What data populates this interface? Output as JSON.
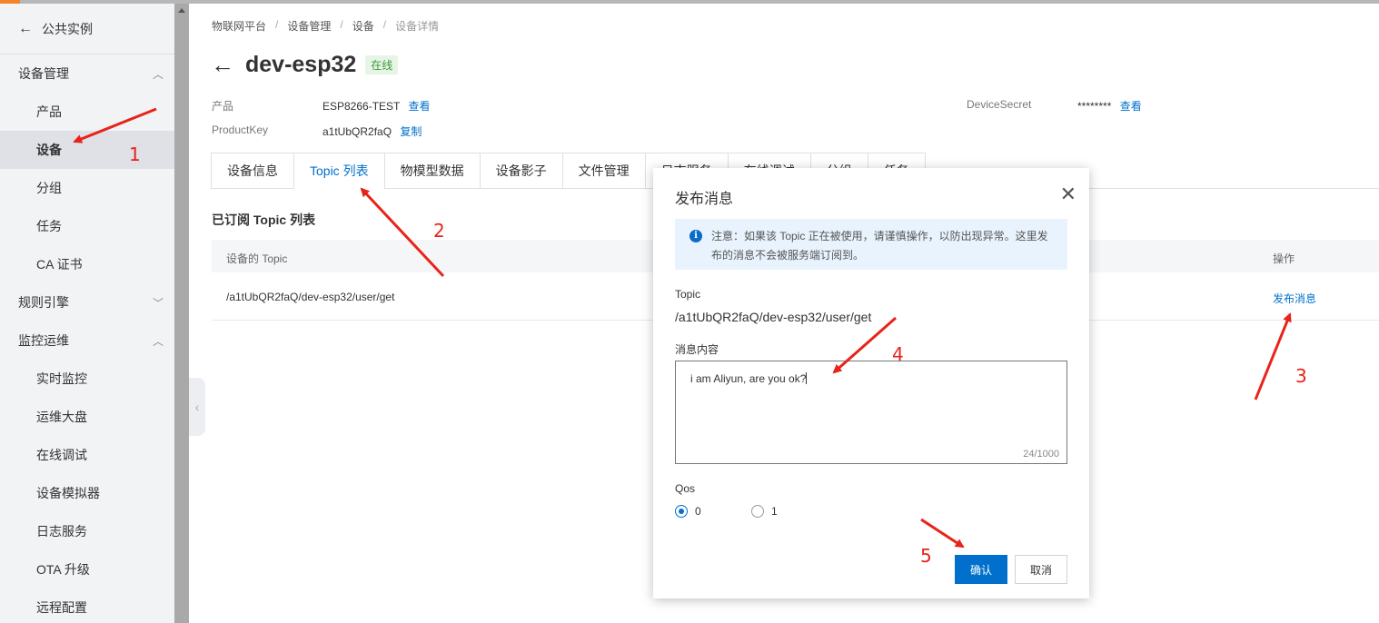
{
  "sidebar": {
    "back_label": "公共实例",
    "groups": [
      {
        "label": "设备管理",
        "items": [
          "产品",
          "设备",
          "分组",
          "任务",
          "CA 证书"
        ]
      },
      {
        "label": "规则引擎",
        "items": []
      },
      {
        "label": "监控运维",
        "items": [
          "实时监控",
          "运维大盘",
          "在线调试",
          "设备模拟器",
          "日志服务",
          "OTA 升级",
          "远程配置"
        ]
      }
    ],
    "active_item": "设备"
  },
  "breadcrumb": [
    "物联网平台",
    "设备管理",
    "设备",
    "设备详情"
  ],
  "device": {
    "name": "dev-esp32",
    "status": "在线",
    "product_label": "产品",
    "product_value": "ESP8266-TEST",
    "product_action": "查看",
    "productkey_label": "ProductKey",
    "productkey_value": "a1tUbQR2faQ",
    "productkey_action": "复制",
    "secret_label": "DeviceSecret",
    "secret_value": "********",
    "secret_action": "查看"
  },
  "tabs": [
    "设备信息",
    "Topic 列表",
    "物模型数据",
    "设备影子",
    "文件管理",
    "日志服务",
    "在线调试",
    "分组",
    "任务"
  ],
  "active_tab": "Topic 列表",
  "topic_section": {
    "title": "已订阅 Topic 列表",
    "col_topic": "设备的 Topic",
    "col_action": "操作",
    "rows": [
      {
        "topic": "/a1tUbQR2faQ/dev-esp32/user/get",
        "action": "发布消息"
      }
    ]
  },
  "modal": {
    "title": "发布消息",
    "notice_line1": "注意：如果该 Topic 正在被使用，请谨慎操作，以防出现异常。这里发",
    "notice_line2": "布的消息不会被服务端订阅到。",
    "topic_label": "Topic",
    "topic_value": "/a1tUbQR2faQ/dev-esp32/user/get",
    "content_label": "消息内容",
    "content_value": "i am Aliyun, are you ok?",
    "counter": "24/1000",
    "qos_label": "Qos",
    "qos_options": [
      "0",
      "1"
    ],
    "qos_selected": "0",
    "confirm_label": "确认",
    "cancel_label": "取消"
  },
  "annotations": [
    "1",
    "2",
    "3",
    "4",
    "5"
  ],
  "colors": {
    "accent": "#0070cc",
    "annotation": "#e8231a",
    "online": "#3a9a3a"
  }
}
